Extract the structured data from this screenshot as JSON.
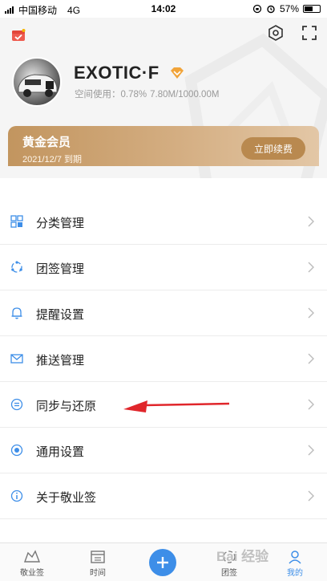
{
  "status_bar": {
    "carrier": "中国移动",
    "network": "4G",
    "time": "14:02",
    "battery": "57%",
    "battery_level": 0.57
  },
  "profile": {
    "username": "EXOTIC·F",
    "storage_label": "空间使用：",
    "storage_percent": "0.78%",
    "storage_amount": "7.80M/1000.00M"
  },
  "membership": {
    "title": "黄金会员",
    "expiry": "2021/12/7 到期",
    "renew_label": "立即续费"
  },
  "menu": {
    "items": [
      {
        "label": "分类管理",
        "icon": "category-icon"
      },
      {
        "label": "团签管理",
        "icon": "team-icon"
      },
      {
        "label": "提醒设置",
        "icon": "bell-icon"
      },
      {
        "label": "推送管理",
        "icon": "mail-icon"
      },
      {
        "label": "同步与还原",
        "icon": "sync-icon"
      },
      {
        "label": "通用设置",
        "icon": "general-icon"
      },
      {
        "label": "关于敬业签",
        "icon": "info-icon"
      }
    ]
  },
  "tabbar": {
    "tabs": [
      {
        "label": "敬业签"
      },
      {
        "label": "时间"
      },
      {
        "label": "团签"
      },
      {
        "label": "我的"
      }
    ],
    "active": "我的"
  },
  "watermark": "Bai 经验",
  "colors": {
    "accent": "#3d8ee8",
    "gold": "#c9a06d",
    "annotation_arrow": "#e0262b"
  }
}
